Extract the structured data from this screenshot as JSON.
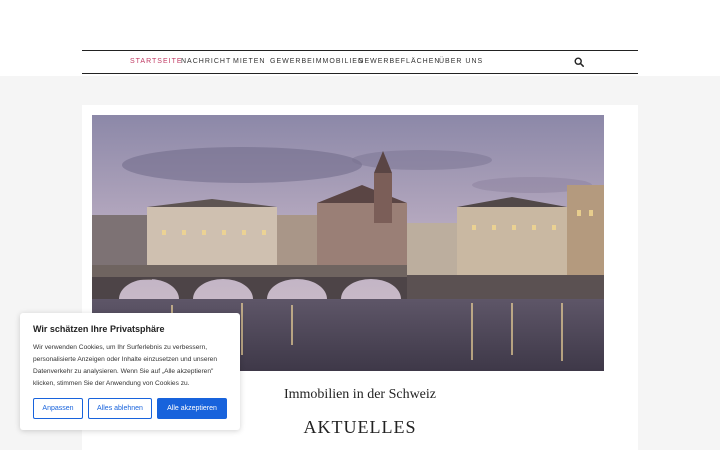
{
  "nav": {
    "items": [
      {
        "label": "STARTSEITE",
        "active": true
      },
      {
        "label": "NACHRICHT"
      },
      {
        "label": "MIETEN"
      },
      {
        "label": "GEWERBEIMMOBILIEN"
      },
      {
        "label": "GEWERBEFLÄCHEN"
      },
      {
        "label": "ÜBER UNS"
      }
    ],
    "search_icon": "search-icon"
  },
  "main": {
    "subtitle": "Immobilien in der Schweiz",
    "heading": "AKTUELLES"
  },
  "cookie": {
    "title": "Wir schätzen Ihre Privatsphäre",
    "text": "Wir verwenden Cookies, um Ihr Surferlebnis zu verbessern, personalisierte Anzeigen oder Inhalte einzusetzen und unseren Datenverkehr zu analysieren. Wenn Sie auf „Alle akzeptieren\" klicken, stimmen Sie der Anwendung von Cookies zu.",
    "buttons": {
      "customize": "Anpassen",
      "reject": "Alles ablehnen",
      "accept": "Alle akzeptieren"
    }
  },
  "colors": {
    "accent": "#c03a63",
    "cookie_blue": "#1863dc"
  }
}
